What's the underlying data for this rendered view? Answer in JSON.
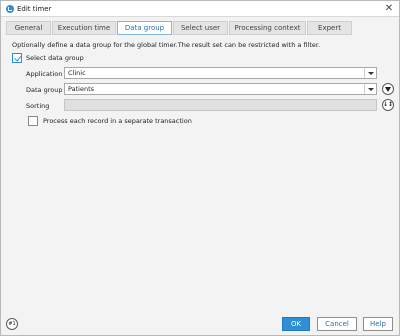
{
  "window": {
    "title": "Edit timer",
    "close_glyph": "✕",
    "icon": "app-timer-icon"
  },
  "tabs": [
    {
      "label": "General",
      "active": false
    },
    {
      "label": "Execution time",
      "active": false
    },
    {
      "label": "Data group",
      "active": true
    },
    {
      "label": "Select user",
      "active": false
    },
    {
      "label": "Processing context",
      "active": false
    },
    {
      "label": "Expert",
      "active": false
    }
  ],
  "content": {
    "description": "Optionally define a data group for the global timer.The result set can be restricted with a filter.",
    "select_data_group": {
      "label": "Select data group",
      "checked": true
    },
    "application": {
      "label": "Application",
      "value": "Clinic"
    },
    "data_group": {
      "label": "Data group",
      "value": "Patients"
    },
    "sorting": {
      "label": "Sorting",
      "value": ""
    },
    "separate_transaction": {
      "label": "Process each record in a separate transaction",
      "checked": false
    }
  },
  "footer": {
    "ok_label": "OK",
    "cancel_label": "Cancel",
    "help_label": "Help",
    "bottom_icon_text": "#1"
  },
  "colors": {
    "accent": "#2d8fd5",
    "active_tab_text": "#2a6fb0"
  }
}
